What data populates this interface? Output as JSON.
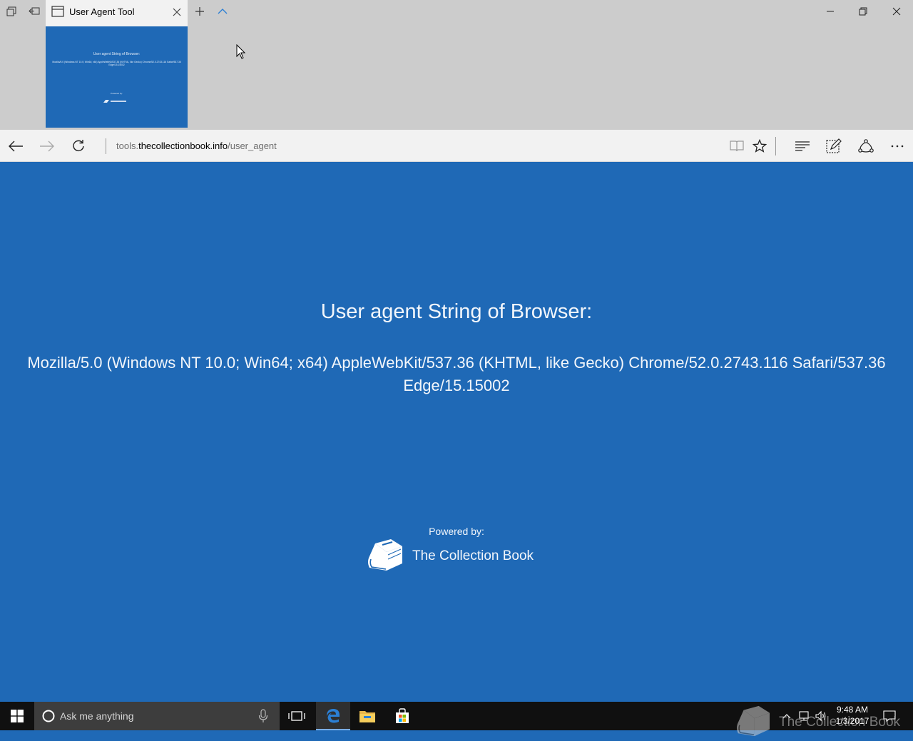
{
  "tab": {
    "title": "User Agent Tool"
  },
  "preview": {
    "title": "User agent String of Browser:",
    "ua": "Mozilla/5.0 (Windows NT 10.0; Win64; x64) AppleWebKit/537.36 (KHTML, like Gecko) Chrome/52.0.2743.116 Safari/537.36 Edge/15.15002",
    "powered": "Powered by:"
  },
  "addressbar": {
    "url_prefix": "tools.",
    "url_domain": "thecollectionbook.info",
    "url_path": "/user_agent"
  },
  "page": {
    "heading": "User agent String of Browser:",
    "ua_line1": "Mozilla/5.0 (Windows NT 10.0; Win64; x64) AppleWebKit/537.36 (KHTML, like Gecko) Chrome/52.0.2743.116 Safari/537.36",
    "ua_line2": "Edge/15.15002",
    "powered_by": "Powered by:",
    "brand_name": "The Collection Book"
  },
  "taskbar": {
    "search_placeholder": "Ask me anything",
    "time": "9:48 AM",
    "date": "1/3/2017"
  },
  "watermark": {
    "text": "The Collection Book"
  },
  "colors": {
    "page_background": "#1f69b6",
    "tabbar_background": "#cccccc",
    "taskbar_background": "#101010",
    "edge_blue": "#2b7fd4"
  }
}
